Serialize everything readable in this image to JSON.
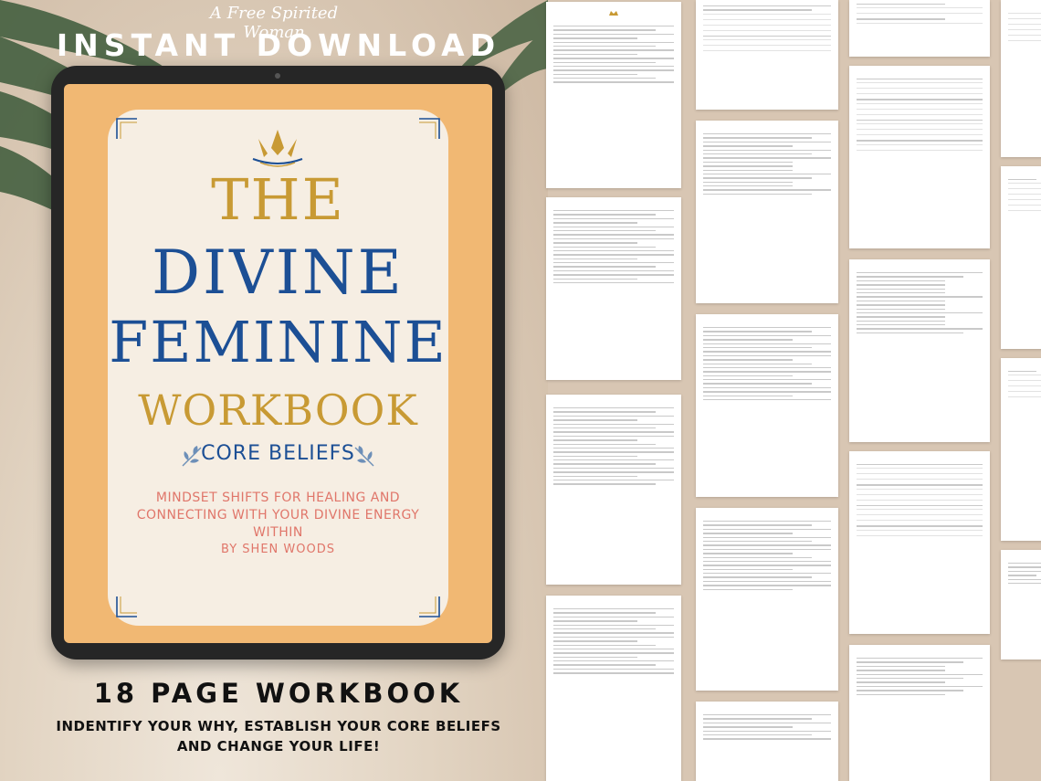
{
  "header": {
    "script_title": "A Free Spirited Woman",
    "main_title": "INSTANT DOWNLOAD"
  },
  "cover": {
    "line1": "THE",
    "line2": "DIVINE",
    "line3": "FEMININE",
    "line4": "WORKBOOK",
    "subtitle": "CORE BELIEFS",
    "tagline": "MINDSET SHIFTS FOR HEALING AND CONNECTING WITH YOUR DIVINE ENERGY WITHIN",
    "author": "BY SHEN WOODS"
  },
  "footer": {
    "page_count": "18 PAGE WORKBOOK",
    "description": "INDENTIFY YOUR WHY, ESTABLISH YOUR CORE BELIEFS AND CHANGE YOUR LIFE!"
  },
  "colors": {
    "gold": "#c89a34",
    "blue": "#1c4f95",
    "coral": "#e0766a",
    "screen": "#f1b873",
    "cream": "#f6eee3"
  },
  "icons": {
    "cover_crown": "crown-icon",
    "sprig": "sprig-icon",
    "palm_leaf": "palm-leaf-icon"
  }
}
